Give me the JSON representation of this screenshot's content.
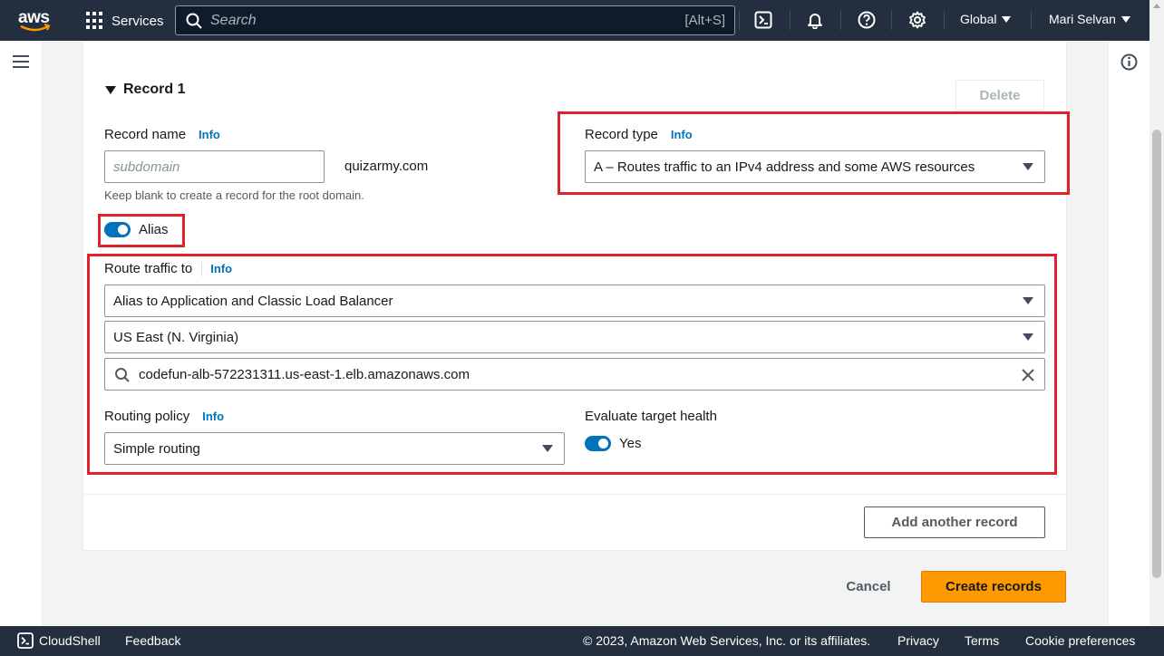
{
  "nav": {
    "logo": "aws",
    "services": "Services",
    "search_placeholder": "Search",
    "search_shortcut": "[Alt+S]",
    "region": "Global",
    "user": "Mari Selvan"
  },
  "record": {
    "title": "Record 1",
    "delete": "Delete",
    "name_label": "Record name",
    "name_info": "Info",
    "name_placeholder": "subdomain",
    "domain": "quizarmy.com",
    "name_hint": "Keep blank to create a record for the root domain.",
    "type_label": "Record type",
    "type_info": "Info",
    "type_value": "A – Routes traffic to an IPv4 address and some AWS resources",
    "alias_label": "Alias",
    "alias_on": true,
    "route_label": "Route traffic to",
    "route_info": "Info",
    "endpoint_type": "Alias to Application and Classic Load Balancer",
    "region": "US East (N. Virginia)",
    "load_balancer": "codefun-alb-572231311.us-east-1.elb.amazonaws.com",
    "routing_label": "Routing policy",
    "routing_info": "Info",
    "routing_value": "Simple routing",
    "health_label": "Evaluate target health",
    "health_value": "Yes",
    "health_on": true
  },
  "actions": {
    "add_another": "Add another record",
    "cancel": "Cancel",
    "create": "Create records"
  },
  "footer": {
    "cloudshell": "CloudShell",
    "feedback": "Feedback",
    "copyright": "© 2023, Amazon Web Services, Inc. or its affiliates.",
    "privacy": "Privacy",
    "terms": "Terms",
    "cookies": "Cookie preferences"
  },
  "colors": {
    "nav_bg": "#232f3e",
    "link_blue": "#0073bb",
    "primary_orange": "#ff9900",
    "highlight_red": "#e0222c"
  }
}
